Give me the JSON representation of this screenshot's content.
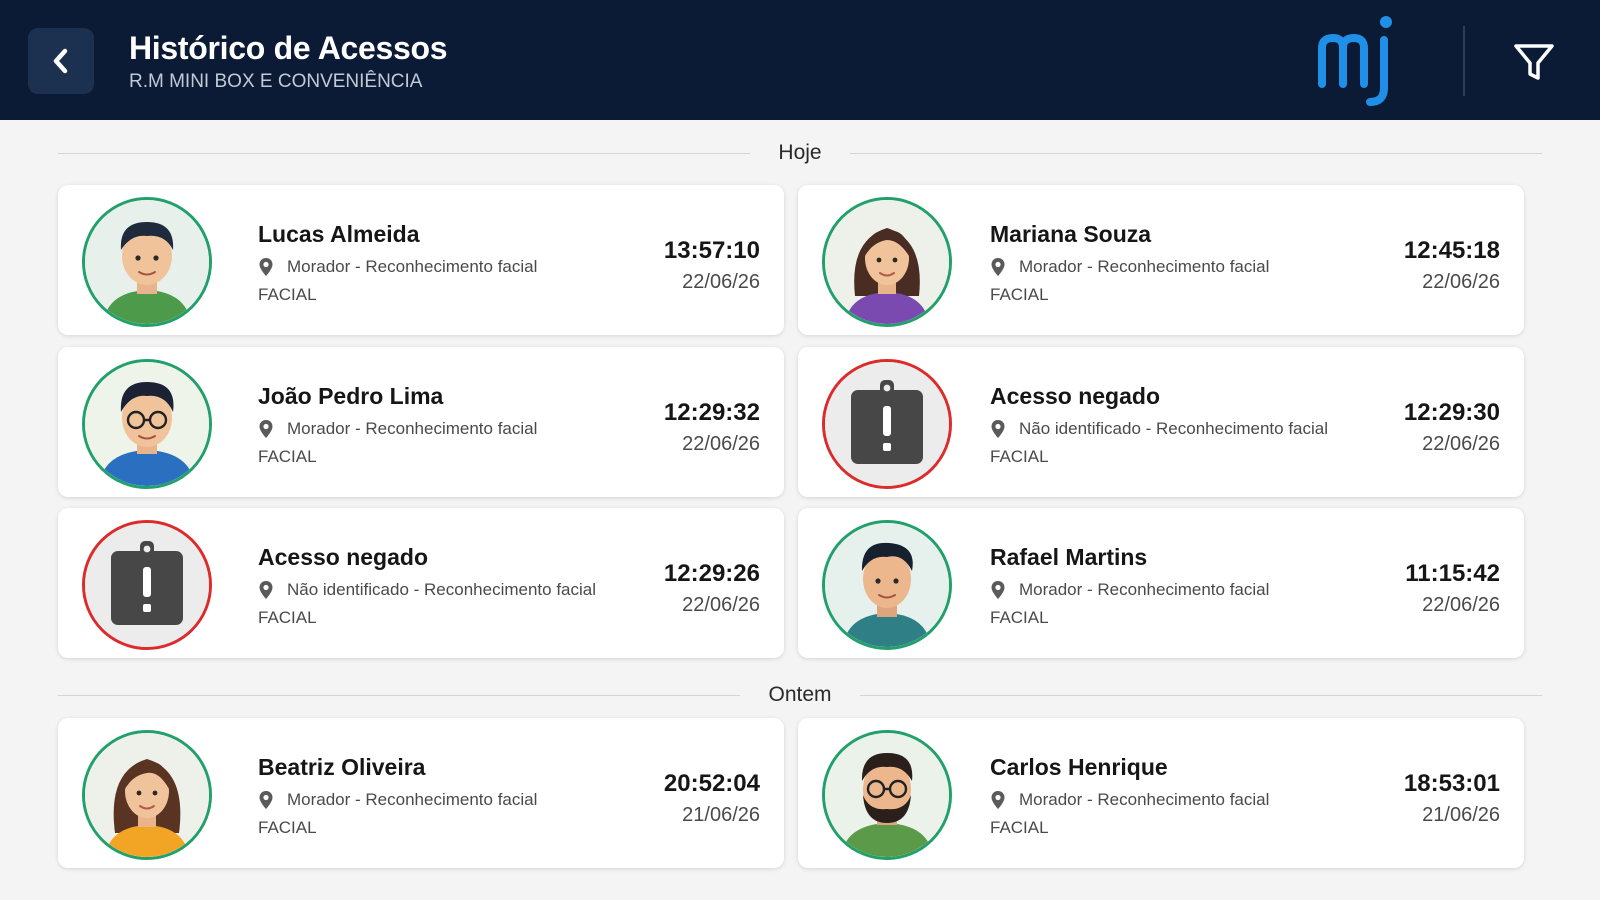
{
  "header": {
    "title": "Histórico de Acessos",
    "subtitle": "R.M MINI BOX E CONVENIÊNCIA",
    "back_icon": "chevron-left-icon",
    "logo_text": "mj",
    "filter_icon": "filter-icon"
  },
  "colors": {
    "header_bg": "#0b1a35",
    "logo_blue": "#1f8fe8",
    "granted_ring": "#22a06b",
    "denied_ring": "#dc2b2b"
  },
  "sections": [
    {
      "label": "Hoje",
      "entries": [
        {
          "name": "Lucas Almeida",
          "detail": "Morador - Reconhecimento facial",
          "method": "FACIAL",
          "time": "13:57:10",
          "date": "22/06/26",
          "status": "granted"
        },
        {
          "name": "Mariana Souza",
          "detail": "Morador - Reconhecimento facial",
          "method": "FACIAL",
          "time": "12:45:18",
          "date": "22/06/26",
          "status": "granted"
        },
        {
          "name": "João Pedro Lima",
          "detail": "Morador - Reconhecimento facial",
          "method": "FACIAL",
          "time": "12:29:32",
          "date": "22/06/26",
          "status": "granted"
        },
        {
          "name": "Acesso negado",
          "detail": "Não identificado - Reconhecimento facial",
          "method": "FACIAL",
          "time": "12:29:30",
          "date": "22/06/26",
          "status": "denied"
        },
        {
          "name": "Acesso negado",
          "detail": "Não identificado - Reconhecimento facial",
          "method": "FACIAL",
          "time": "12:29:26",
          "date": "22/06/26",
          "status": "denied"
        },
        {
          "name": "Rafael Martins",
          "detail": "Morador - Reconhecimento facial",
          "method": "FACIAL",
          "time": "11:15:42",
          "date": "22/06/26",
          "status": "granted"
        }
      ]
    },
    {
      "label": "Ontem",
      "entries": [
        {
          "name": "Beatriz Oliveira",
          "detail": "Morador - Reconhecimento facial",
          "method": "FACIAL",
          "time": "20:52:04",
          "date": "21/06/26",
          "status": "granted"
        },
        {
          "name": "Carlos Henrique",
          "detail": "Morador - Reconhecimento facial",
          "method": "FACIAL",
          "time": "18:53:01",
          "date": "21/06/26",
          "status": "granted"
        }
      ]
    }
  ]
}
